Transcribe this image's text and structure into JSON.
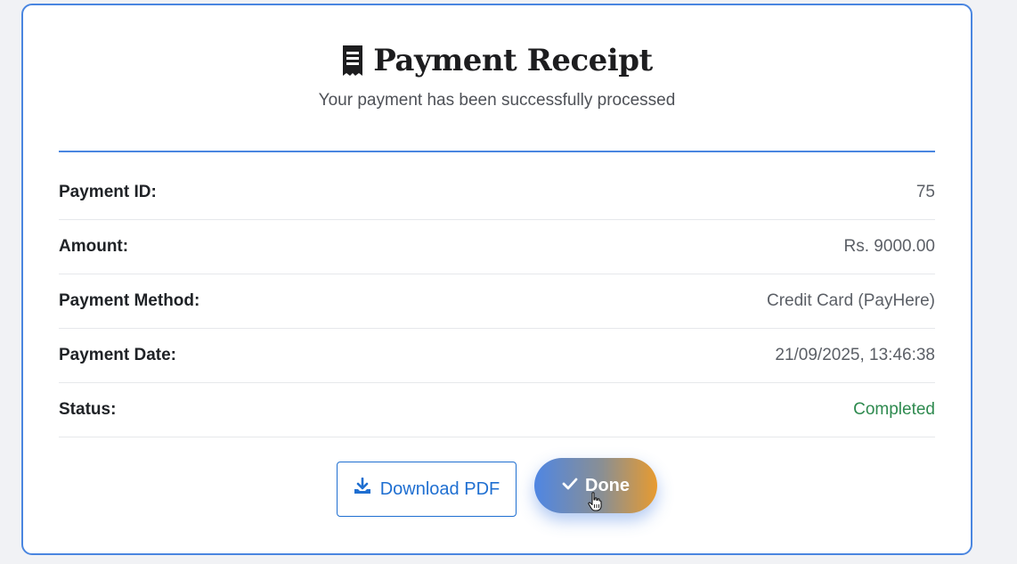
{
  "header": {
    "icon": "receipt-icon",
    "title": "Payment Receipt",
    "subtitle": "Your payment has been successfully processed"
  },
  "details": [
    {
      "label": "Payment ID:",
      "value": "75"
    },
    {
      "label": "Amount:",
      "value": "Rs. 9000.00"
    },
    {
      "label": "Payment Method:",
      "value": "Credit Card (PayHere)"
    },
    {
      "label": "Payment Date:",
      "value": "21/09/2025, 13:46:38"
    },
    {
      "label": "Status:",
      "value": "Completed"
    }
  ],
  "actions": {
    "download_label": "Download PDF",
    "download_icon": "download-icon",
    "done_label": "Done",
    "done_icon": "check-icon"
  },
  "colors": {
    "accent": "#4a86e0",
    "status_completed": "#2e8a4f",
    "download": "#1f6fd1"
  }
}
